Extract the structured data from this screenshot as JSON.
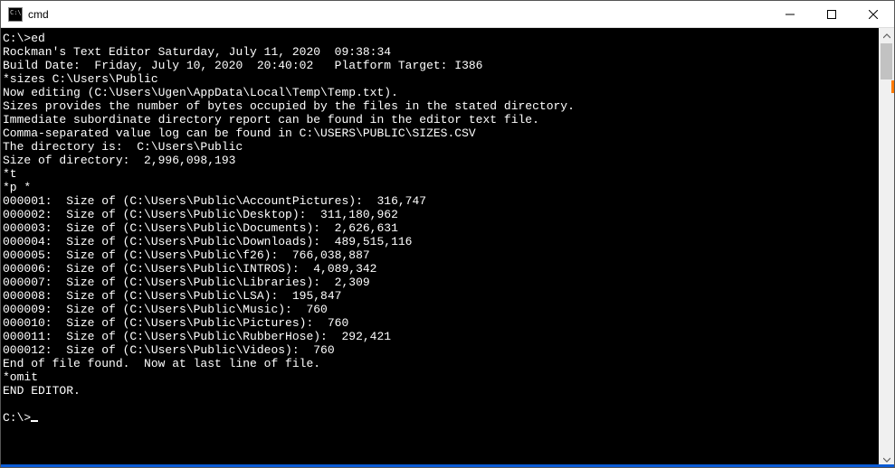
{
  "window": {
    "title": "cmd"
  },
  "terminal": {
    "lines": [
      "C:\\>ed",
      "Rockman's Text Editor Saturday, July 11, 2020  09:38:34",
      "Build Date:  Friday, July 10, 2020  20:40:02   Platform Target: I386",
      "*sizes C:\\Users\\Public",
      "Now editing (C:\\Users\\Ugen\\AppData\\Local\\Temp\\Temp.txt).",
      "Sizes provides the number of bytes occupied by the files in the stated directory.",
      "Immediate subordinate directory report can be found in the editor text file.",
      "Comma-separated value log can be found in C:\\USERS\\PUBLIC\\SIZES.CSV",
      "The directory is:  C:\\Users\\Public",
      "Size of directory:  2,996,098,193",
      "*t",
      "*p *",
      "000001:  Size of (C:\\Users\\Public\\AccountPictures):  316,747",
      "000002:  Size of (C:\\Users\\Public\\Desktop):  311,180,962",
      "000003:  Size of (C:\\Users\\Public\\Documents):  2,626,631",
      "000004:  Size of (C:\\Users\\Public\\Downloads):  489,515,116",
      "000005:  Size of (C:\\Users\\Public\\f26):  766,038,887",
      "000006:  Size of (C:\\Users\\Public\\INTROS):  4,089,342",
      "000007:  Size of (C:\\Users\\Public\\Libraries):  2,309",
      "000008:  Size of (C:\\Users\\Public\\LSA):  195,847",
      "000009:  Size of (C:\\Users\\Public\\Music):  760",
      "000010:  Size of (C:\\Users\\Public\\Pictures):  760",
      "000011:  Size of (C:\\Users\\Public\\RubberHose):  292,421",
      "000012:  Size of (C:\\Users\\Public\\Videos):  760",
      "End of file found.  Now at last line of file.",
      "*omit",
      "END EDITOR.",
      "",
      "C:\\>"
    ]
  }
}
